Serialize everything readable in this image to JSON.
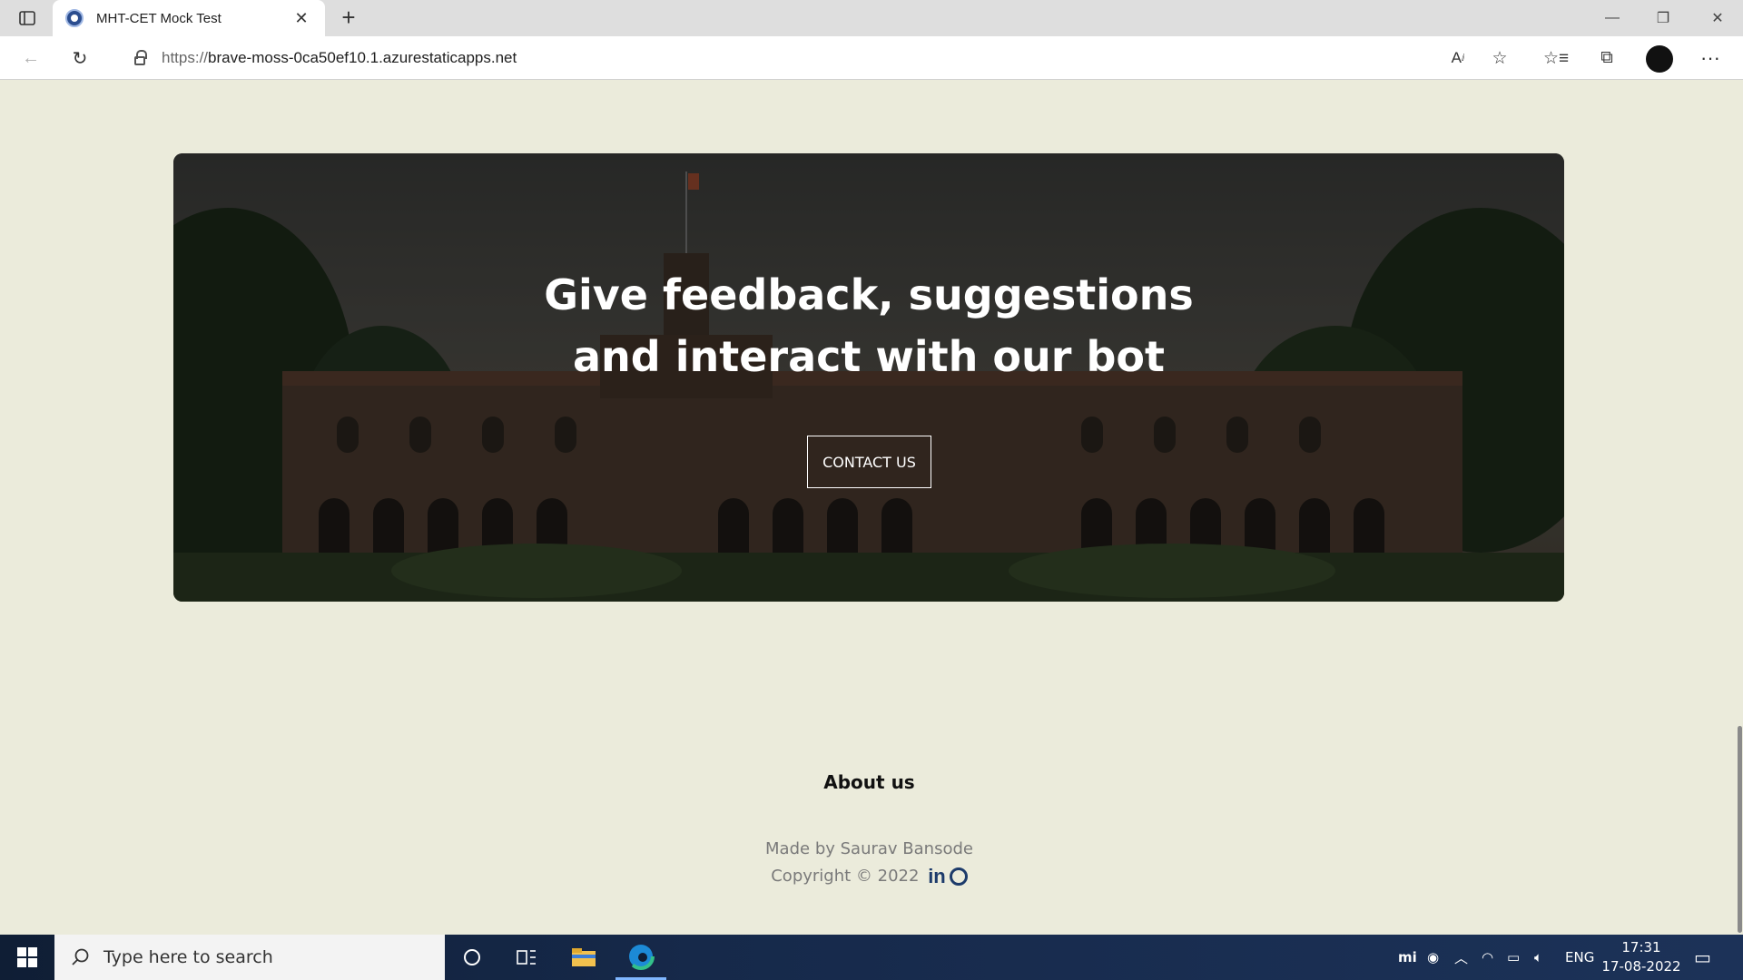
{
  "browser": {
    "tab_title": "MHT-CET Mock Test",
    "new_tab_icon": "plus-icon",
    "url_scheme": "https://",
    "url_host": "brave-moss-0ca50ef10.1.azurestaticapps.net"
  },
  "hero": {
    "title_line1": "Give feedback, suggestions",
    "title_line2": "and interact with our bot",
    "button_label": "CONTACT US"
  },
  "footer": {
    "about_title": "About us",
    "made_by": "Made by Saurav Bansode",
    "copyright": "Copyright © 2022",
    "linkedin_label": "in"
  },
  "taskbar": {
    "search_placeholder": "Type here to search",
    "language": "ENG",
    "time": "17:31",
    "date": "17-08-2022"
  },
  "colors": {
    "page_background": "#ebebdb",
    "social_icon": "#1d3b6b",
    "footer_text": "#7a7a7a"
  }
}
